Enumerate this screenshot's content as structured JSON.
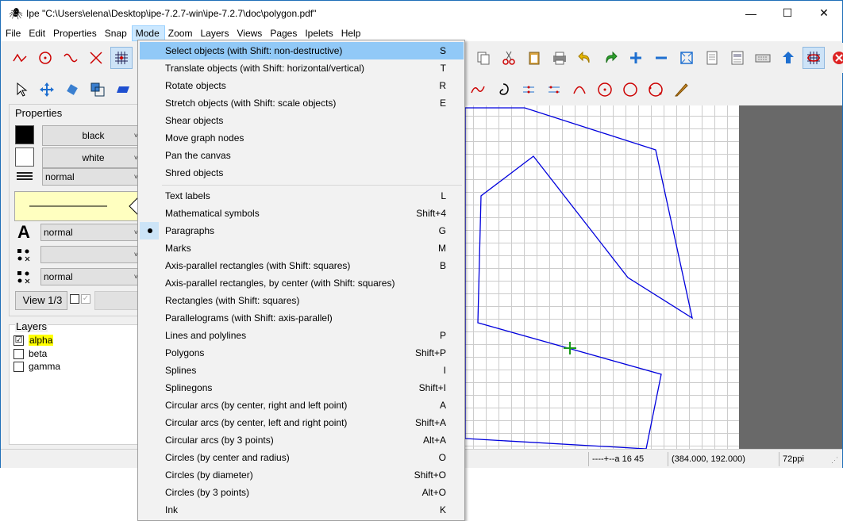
{
  "window": {
    "title": "Ipe \"C:\\Users\\elena\\Desktop\\ipe-7.2.7-win\\ipe-7.2.7\\doc\\polygon.pdf\"",
    "minimize": "—",
    "maximize": "☐",
    "close": "✕"
  },
  "menubar": [
    "File",
    "Edit",
    "Properties",
    "Snap",
    "Mode",
    "Zoom",
    "Layers",
    "Views",
    "Pages",
    "Ipelets",
    "Help"
  ],
  "properties": {
    "title": "Properties",
    "stroke": "black",
    "fill": "white",
    "pen": "normal",
    "textsize": "normal",
    "marksize": "",
    "symbolsize": "normal",
    "view_button": "View 1/3"
  },
  "layers": {
    "title": "Layers",
    "items": [
      {
        "name": "alpha",
        "checked": "☑",
        "active": true
      },
      {
        "name": "beta",
        "checked": "",
        "active": false
      },
      {
        "name": "gamma",
        "checked": "",
        "active": false
      }
    ]
  },
  "mode_menu": {
    "items": [
      {
        "label": "Select objects (with Shift: non-destructive)",
        "shortcut": "S"
      },
      {
        "label": "Translate objects (with Shift: horizontal/vertical)",
        "shortcut": "T"
      },
      {
        "label": "Rotate objects",
        "shortcut": "R"
      },
      {
        "label": "Stretch objects (with Shift: scale objects)",
        "shortcut": "E"
      },
      {
        "label": "Shear objects",
        "shortcut": ""
      },
      {
        "label": "Move graph nodes",
        "shortcut": ""
      },
      {
        "label": "Pan the canvas",
        "shortcut": ""
      },
      {
        "label": "Shred objects",
        "shortcut": ""
      },
      {
        "label": "Text labels",
        "shortcut": "L"
      },
      {
        "label": "Mathematical symbols",
        "shortcut": "Shift+4"
      },
      {
        "label": "Paragraphs",
        "shortcut": "G"
      },
      {
        "label": "Marks",
        "shortcut": "M"
      },
      {
        "label": "Axis-parallel rectangles (with Shift: squares)",
        "shortcut": "B"
      },
      {
        "label": "Axis-parallel rectangles, by center (with Shift: squares)",
        "shortcut": ""
      },
      {
        "label": "Rectangles (with Shift: squares)",
        "shortcut": ""
      },
      {
        "label": "Parallelograms (with Shift: axis-parallel)",
        "shortcut": ""
      },
      {
        "label": "Lines and polylines",
        "shortcut": "P"
      },
      {
        "label": "Polygons",
        "shortcut": "Shift+P"
      },
      {
        "label": "Splines",
        "shortcut": "I"
      },
      {
        "label": "Splinegons",
        "shortcut": "Shift+I"
      },
      {
        "label": "Circular arcs (by center, right and left point)",
        "shortcut": "A"
      },
      {
        "label": "Circular arcs (by center, left and right point)",
        "shortcut": "Shift+A"
      },
      {
        "label": "Circular arcs (by 3 points)",
        "shortcut": "Alt+A"
      },
      {
        "label": "Circles (by center and radius)",
        "shortcut": "O"
      },
      {
        "label": "Circles (by diameter)",
        "shortcut": "Shift+O"
      },
      {
        "label": "Circles (by 3 points)",
        "shortcut": "Alt+O"
      },
      {
        "label": "Ink",
        "shortcut": "K"
      }
    ],
    "checked_item": "Paragraphs"
  },
  "status": {
    "snap": "----+--a 16 45",
    "coords": "(384.000, 192.000)",
    "resolution": "72ppi"
  },
  "colors": {
    "highlight": "#91c9f7",
    "polygon_stroke": "#0000dd",
    "layer_highlight": "#ffff00"
  }
}
